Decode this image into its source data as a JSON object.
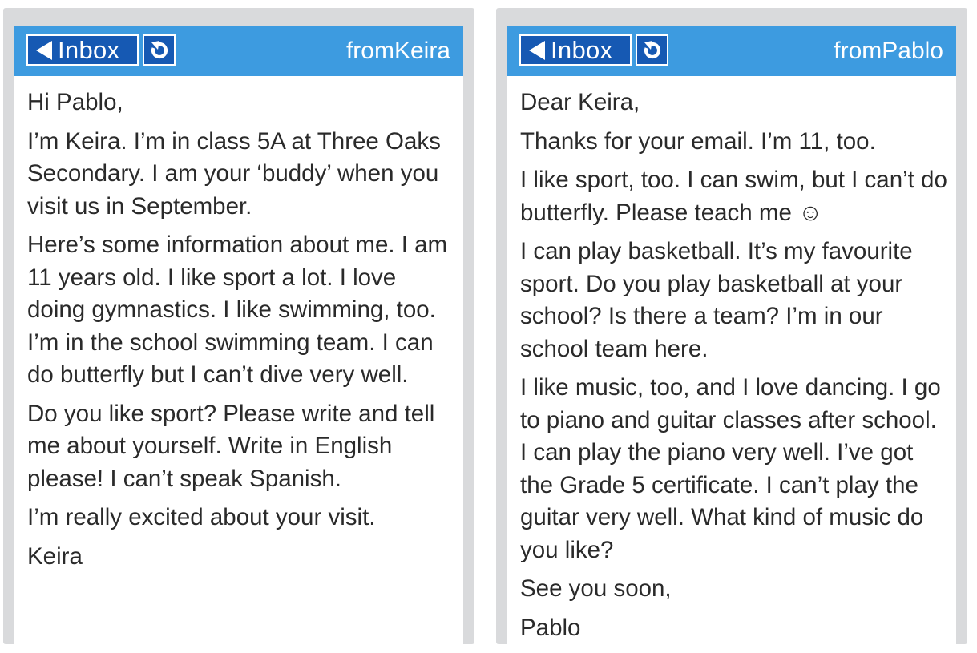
{
  "panels": [
    {
      "header": {
        "inbox_label": "Inbox",
        "refresh_icon": "refresh-icon",
        "from_prefix": "from",
        "from_name": "Keira"
      },
      "paragraphs": [
        "Hi Pablo,",
        "I’m Keira. I’m in class 5A at Three Oaks Secondary. I am your ‘buddy’ when you visit us in September.",
        "Here’s some information about me. I am 11 years old. I like sport a lot. I love doing gymnastics. I like swimming, too. I’m in the school swimming team. I can do butterfly but I can’t dive very well.",
        "Do you like sport? Please write and tell me about yourself. Write in English please! I can’t speak Spanish.",
        "I’m really excited about your visit.",
        "Keira"
      ]
    },
    {
      "header": {
        "inbox_label": "Inbox",
        "refresh_icon": "refresh-icon",
        "from_prefix": "from",
        "from_name": "Pablo"
      },
      "paragraphs": [
        "Dear Keira,",
        "Thanks for your email. I’m 11, too.",
        "I like sport, too. I can swim, but I can’t do butterfly. Please teach me ☺",
        "I can play basketball. It’s my favourite sport. Do you play basketball at your school? Is there a team? I’m in our school team here.",
        "I like music, too, and I love dancing. I go to piano and guitar classes after school. I can play the piano very well. I’ve got the Grade 5 certificate. I can’t play the guitar very well. What kind of music do you like?",
        "See you soon,",
        "Pablo"
      ]
    }
  ],
  "colors": {
    "header_blue": "#3d9be0",
    "button_blue": "#1659b3",
    "frame_gray": "#d9dadc",
    "text": "#2a2a2a"
  }
}
